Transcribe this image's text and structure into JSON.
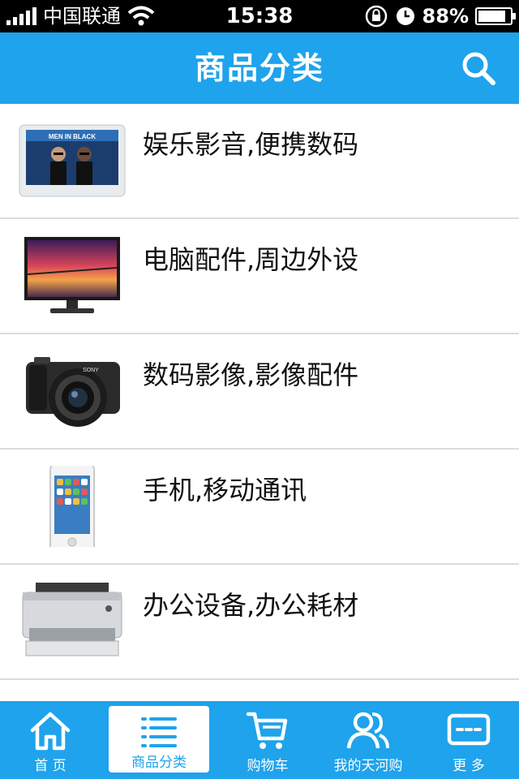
{
  "status_bar": {
    "carrier": "中国联通",
    "time": "15:38",
    "battery_percent": "88%",
    "battery_level": 0.88,
    "signal_bars": 5
  },
  "header": {
    "title": "商品分类",
    "search_icon": "search-icon",
    "color": "#1ea3ec"
  },
  "categories": [
    {
      "label": "娱乐影音,便携数码",
      "icon": "media-player-thumbnail"
    },
    {
      "label": "电脑配件,周边外设",
      "icon": "monitor-thumbnail"
    },
    {
      "label": "数码影像,影像配件",
      "icon": "camera-thumbnail"
    },
    {
      "label": "手机,移动通讯",
      "icon": "phone-thumbnail"
    },
    {
      "label": "办公设备,办公耗材",
      "icon": "printer-thumbnail"
    }
  ],
  "tabbar": {
    "tabs": [
      {
        "label": "首 页",
        "icon": "home-icon",
        "active": false
      },
      {
        "label": "商品分类",
        "icon": "category-list-icon",
        "active": true
      },
      {
        "label": "购物车",
        "icon": "cart-icon",
        "active": false
      },
      {
        "label": "我的天河购",
        "icon": "user-icon",
        "active": false
      },
      {
        "label": "更 多",
        "icon": "more-icon",
        "active": false
      }
    ]
  }
}
